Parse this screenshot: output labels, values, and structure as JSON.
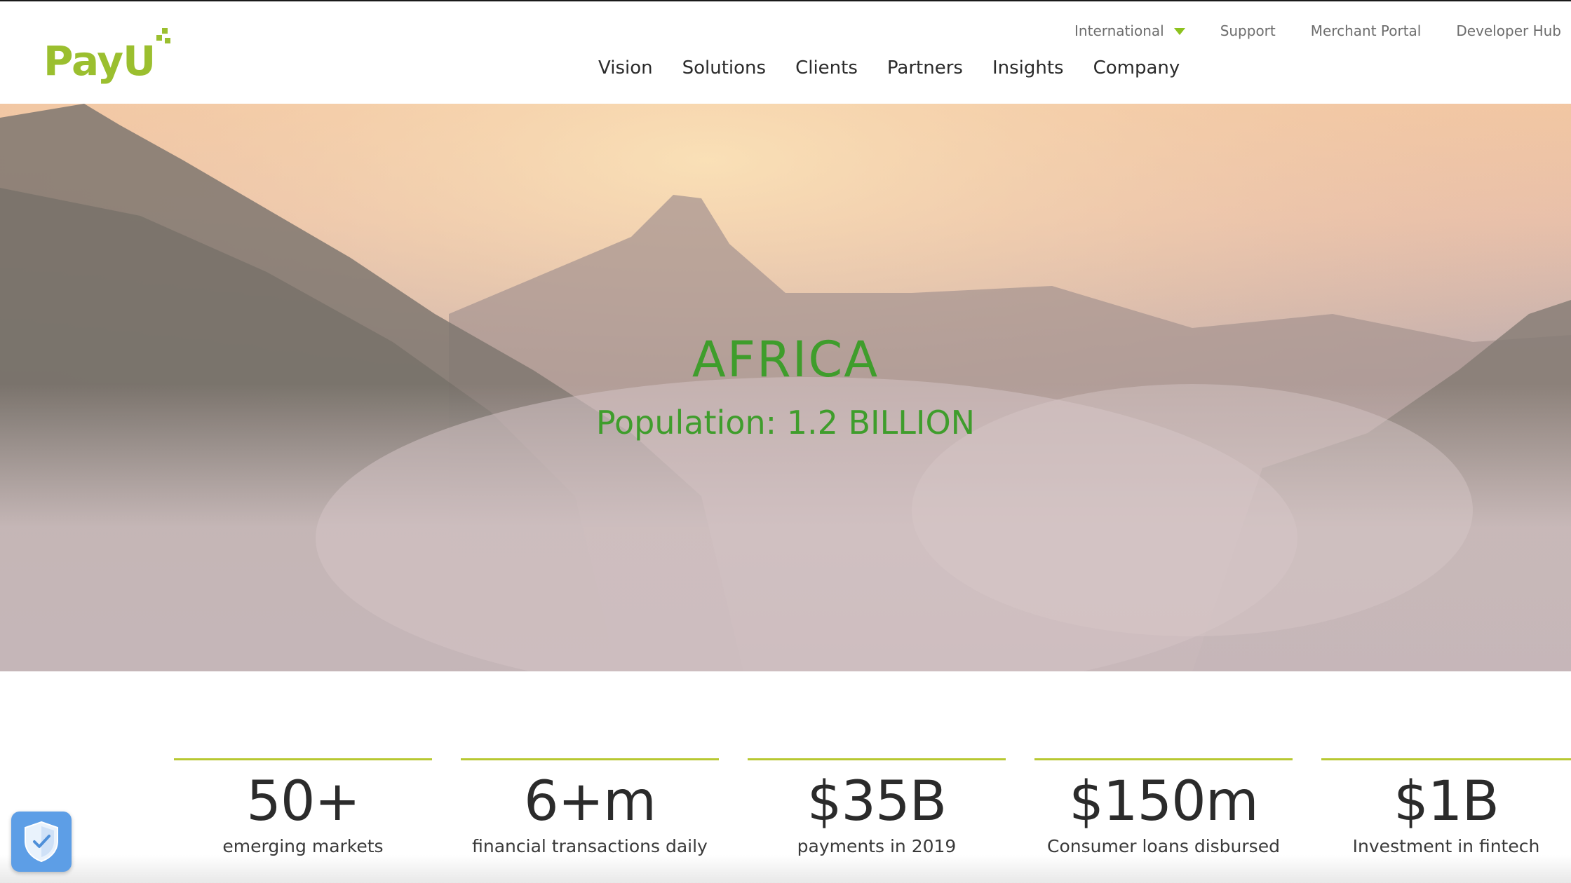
{
  "brand": {
    "logo_text": "PayU",
    "accent_color": "#9bbf2f",
    "headline_color": "#3f9d2c"
  },
  "topnav": {
    "items": [
      {
        "label": "International",
        "has_dropdown": true
      },
      {
        "label": "Support"
      },
      {
        "label": "Merchant Portal"
      },
      {
        "label": "Developer Hub"
      }
    ]
  },
  "mainnav": {
    "items": [
      {
        "label": "Vision"
      },
      {
        "label": "Solutions"
      },
      {
        "label": "Clients"
      },
      {
        "label": "Partners"
      },
      {
        "label": "Insights"
      },
      {
        "label": "Company"
      }
    ]
  },
  "hero": {
    "title": "AFRICA",
    "subtitle": "Population: 1.2 BILLION"
  },
  "stats": [
    {
      "value": "50+",
      "label": "emerging markets"
    },
    {
      "value": "6+m",
      "label": "financial transactions daily"
    },
    {
      "value": "$35B",
      "label": "payments in 2019"
    },
    {
      "value": "$150m",
      "label": "Consumer loans disbursed"
    },
    {
      "value": "$1B",
      "label": "Investment in fintech"
    }
  ],
  "icons": {
    "privacy_badge": "shield-check-icon",
    "dropdown": "caret-down-icon"
  }
}
